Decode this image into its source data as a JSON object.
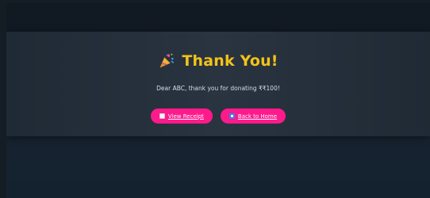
{
  "thankyou": {
    "title": "Thank You!",
    "title_icon": "party-popper-icon",
    "message": "Dear ABC, thank you for donating ₹₹100!"
  },
  "actions": {
    "view_receipt_label": "View Receipt",
    "view_receipt_icon": "receipt-icon",
    "back_home_label": "Back to Home",
    "back_home_icon": "home-icon"
  },
  "colors": {
    "title": "#f2c31a",
    "button": "#ff1a8c",
    "background": "#18232e"
  }
}
